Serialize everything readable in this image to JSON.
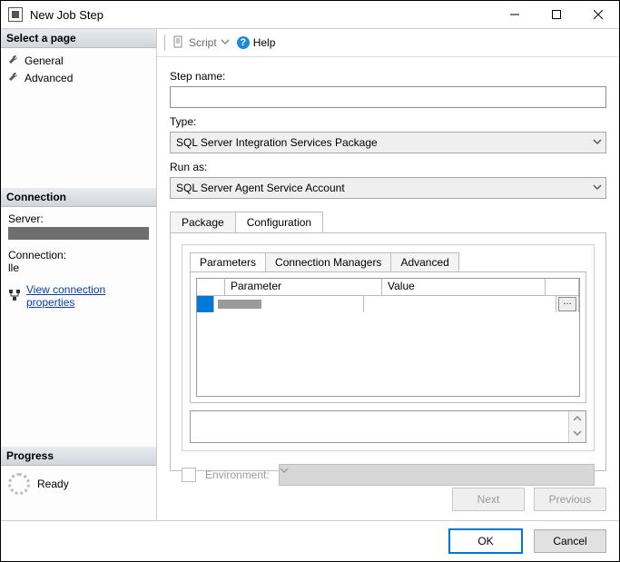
{
  "window": {
    "title": "New Job Step"
  },
  "sidebar": {
    "select_page": "Select a page",
    "pages": [
      {
        "label": "General"
      },
      {
        "label": "Advanced"
      }
    ],
    "connection_hdr": "Connection",
    "server_label": "Server:",
    "connection_label": "Connection:",
    "connection_value": "lle",
    "view_conn_props": "View connection properties",
    "progress_hdr": "Progress",
    "progress_status": "Ready"
  },
  "toolbar": {
    "script_label": "Script",
    "help_label": "Help"
  },
  "form": {
    "step_name_label": "Step name:",
    "step_name_value": "",
    "type_label": "Type:",
    "type_value": "SQL Server Integration Services Package",
    "run_as_label": "Run as:",
    "run_as_value": "SQL Server Agent Service Account"
  },
  "tabs": {
    "package": "Package",
    "configuration": "Configuration"
  },
  "inner_tabs": {
    "parameters": "Parameters",
    "connection_managers": "Connection Managers",
    "advanced": "Advanced"
  },
  "grid": {
    "col_parameter": "Parameter",
    "col_value": "Value"
  },
  "env": {
    "label": "Environment:"
  },
  "nav": {
    "next": "Next",
    "previous": "Previous"
  },
  "footer": {
    "ok": "OK",
    "cancel": "Cancel"
  }
}
